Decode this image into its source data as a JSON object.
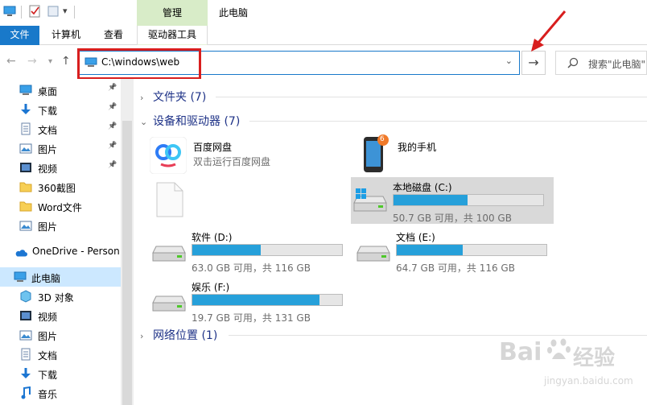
{
  "window": {
    "title": "此电脑"
  },
  "ribbon": {
    "contextual_group": "管理",
    "tabs": {
      "file": "文件",
      "computer": "计算机",
      "view": "查看",
      "drive_tools": "驱动器工具"
    }
  },
  "address": {
    "path": "C:\\windows\\web"
  },
  "search": {
    "placeholder": "搜索\"此电脑\""
  },
  "nav": {
    "quick": [
      {
        "label": "桌面",
        "icon": "desktop-icon",
        "pinned": true
      },
      {
        "label": "下载",
        "icon": "download-icon",
        "pinned": true
      },
      {
        "label": "文档",
        "icon": "document-icon",
        "pinned": true
      },
      {
        "label": "图片",
        "icon": "picture-icon",
        "pinned": true
      },
      {
        "label": "视频",
        "icon": "video-icon",
        "pinned": true
      },
      {
        "label": "360截图",
        "icon": "folder-icon",
        "pinned": false
      },
      {
        "label": "Word文件",
        "icon": "folder-icon",
        "pinned": false
      },
      {
        "label": "图片",
        "icon": "picture-icon",
        "pinned": false
      }
    ],
    "onedrive": "OneDrive - Person",
    "this_pc": "此电脑",
    "pc_children": [
      {
        "label": "3D 对象",
        "icon": "3d-objects-icon"
      },
      {
        "label": "视频",
        "icon": "video-icon"
      },
      {
        "label": "图片",
        "icon": "picture-icon"
      },
      {
        "label": "文档",
        "icon": "document-icon"
      },
      {
        "label": "下载",
        "icon": "download-icon"
      },
      {
        "label": "音乐",
        "icon": "music-icon"
      }
    ]
  },
  "content": {
    "groups": {
      "folders": "文件夹 (7)",
      "devices": "设备和驱动器 (7)",
      "network": "网络位置 (1)"
    },
    "devices": {
      "baidu": {
        "name": "百度网盘",
        "sub": "双击运行百度网盘"
      },
      "phone": {
        "name": "我的手机",
        "badge": "6"
      }
    },
    "drives": [
      {
        "name": "本地磁盘 (C:)",
        "free": "50.7 GB 可用，共 100 GB",
        "used_fraction": 0.493,
        "selected": true
      },
      {
        "name": "软件 (D:)",
        "free": "63.0 GB 可用，共 116 GB",
        "used_fraction": 0.457,
        "selected": false
      },
      {
        "name": "文档 (E:)",
        "free": "64.7 GB 可用，共 116 GB",
        "used_fraction": 0.442,
        "selected": false
      },
      {
        "name": "娱乐 (F:)",
        "free": "19.7 GB 可用，共 131 GB",
        "used_fraction": 0.85,
        "selected": false
      }
    ]
  },
  "colors": {
    "accent": "#1979ca",
    "bar_fill": "#26a0da",
    "annotation_red": "#d81e1e",
    "contextual_green": "#d8ecc8"
  },
  "watermark": {
    "brand": "Bai",
    "brand2": "经验",
    "url": "jingyan.baidu.com"
  }
}
